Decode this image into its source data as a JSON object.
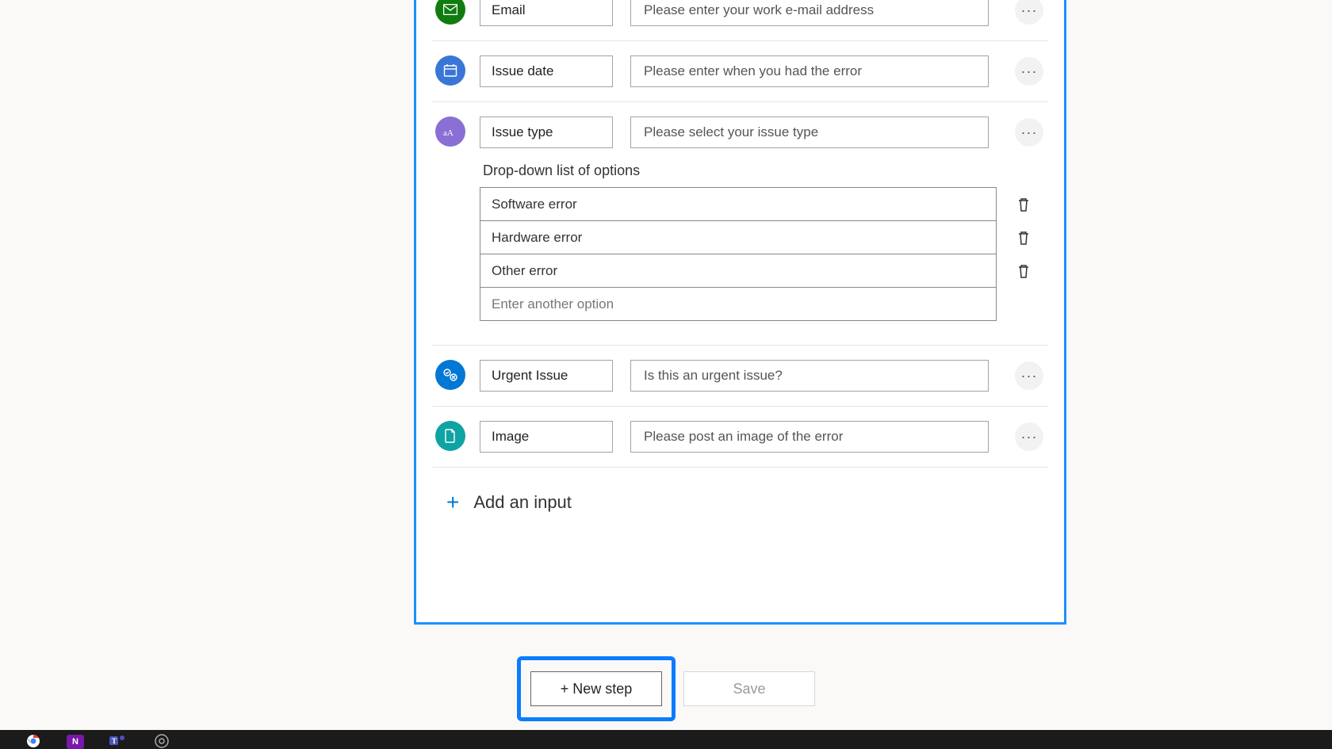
{
  "inputs": {
    "email": {
      "name": "Email",
      "desc": "Please enter your work e-mail address"
    },
    "date": {
      "name": "Issue date",
      "desc": "Please enter when you had the error"
    },
    "type": {
      "name": "Issue type",
      "desc": "Please select your issue type"
    },
    "urgent": {
      "name": "Urgent Issue",
      "desc": "Is this an urgent issue?"
    },
    "image": {
      "name": "Image",
      "desc": "Please post an image of the error"
    }
  },
  "dropdown": {
    "label": "Drop-down list of options",
    "options": [
      "Software error",
      "Hardware error",
      "Other error"
    ],
    "placeholder": "Enter another option"
  },
  "addInputLabel": "Add an input",
  "buttons": {
    "newStep": "+ New step",
    "save": "Save"
  }
}
